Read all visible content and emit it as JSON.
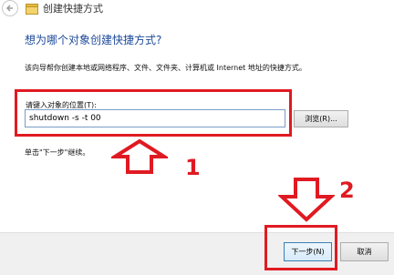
{
  "window": {
    "title": "创建快捷方式"
  },
  "wizard": {
    "heading": "想为哪个对象创建快捷方式?",
    "description": "该向导帮你创建本地或网络程序、文件、文件夹、计算机或 Internet 地址的快捷方式。",
    "location_label": "请键入对象的位置(T):",
    "location_value": "shutdown -s -t 00",
    "browse_label": "浏览(R)...",
    "hint": "单击\"下一步\"继续。"
  },
  "footer": {
    "next_label": "下一步(N)",
    "cancel_label": "取消"
  },
  "annotations": {
    "step1": "1",
    "step2": "2",
    "color": "#e01a22"
  },
  "icons": [
    "back-arrow-icon",
    "shortcut-icon",
    "up-arrow-icon",
    "down-arrow-icon"
  ]
}
